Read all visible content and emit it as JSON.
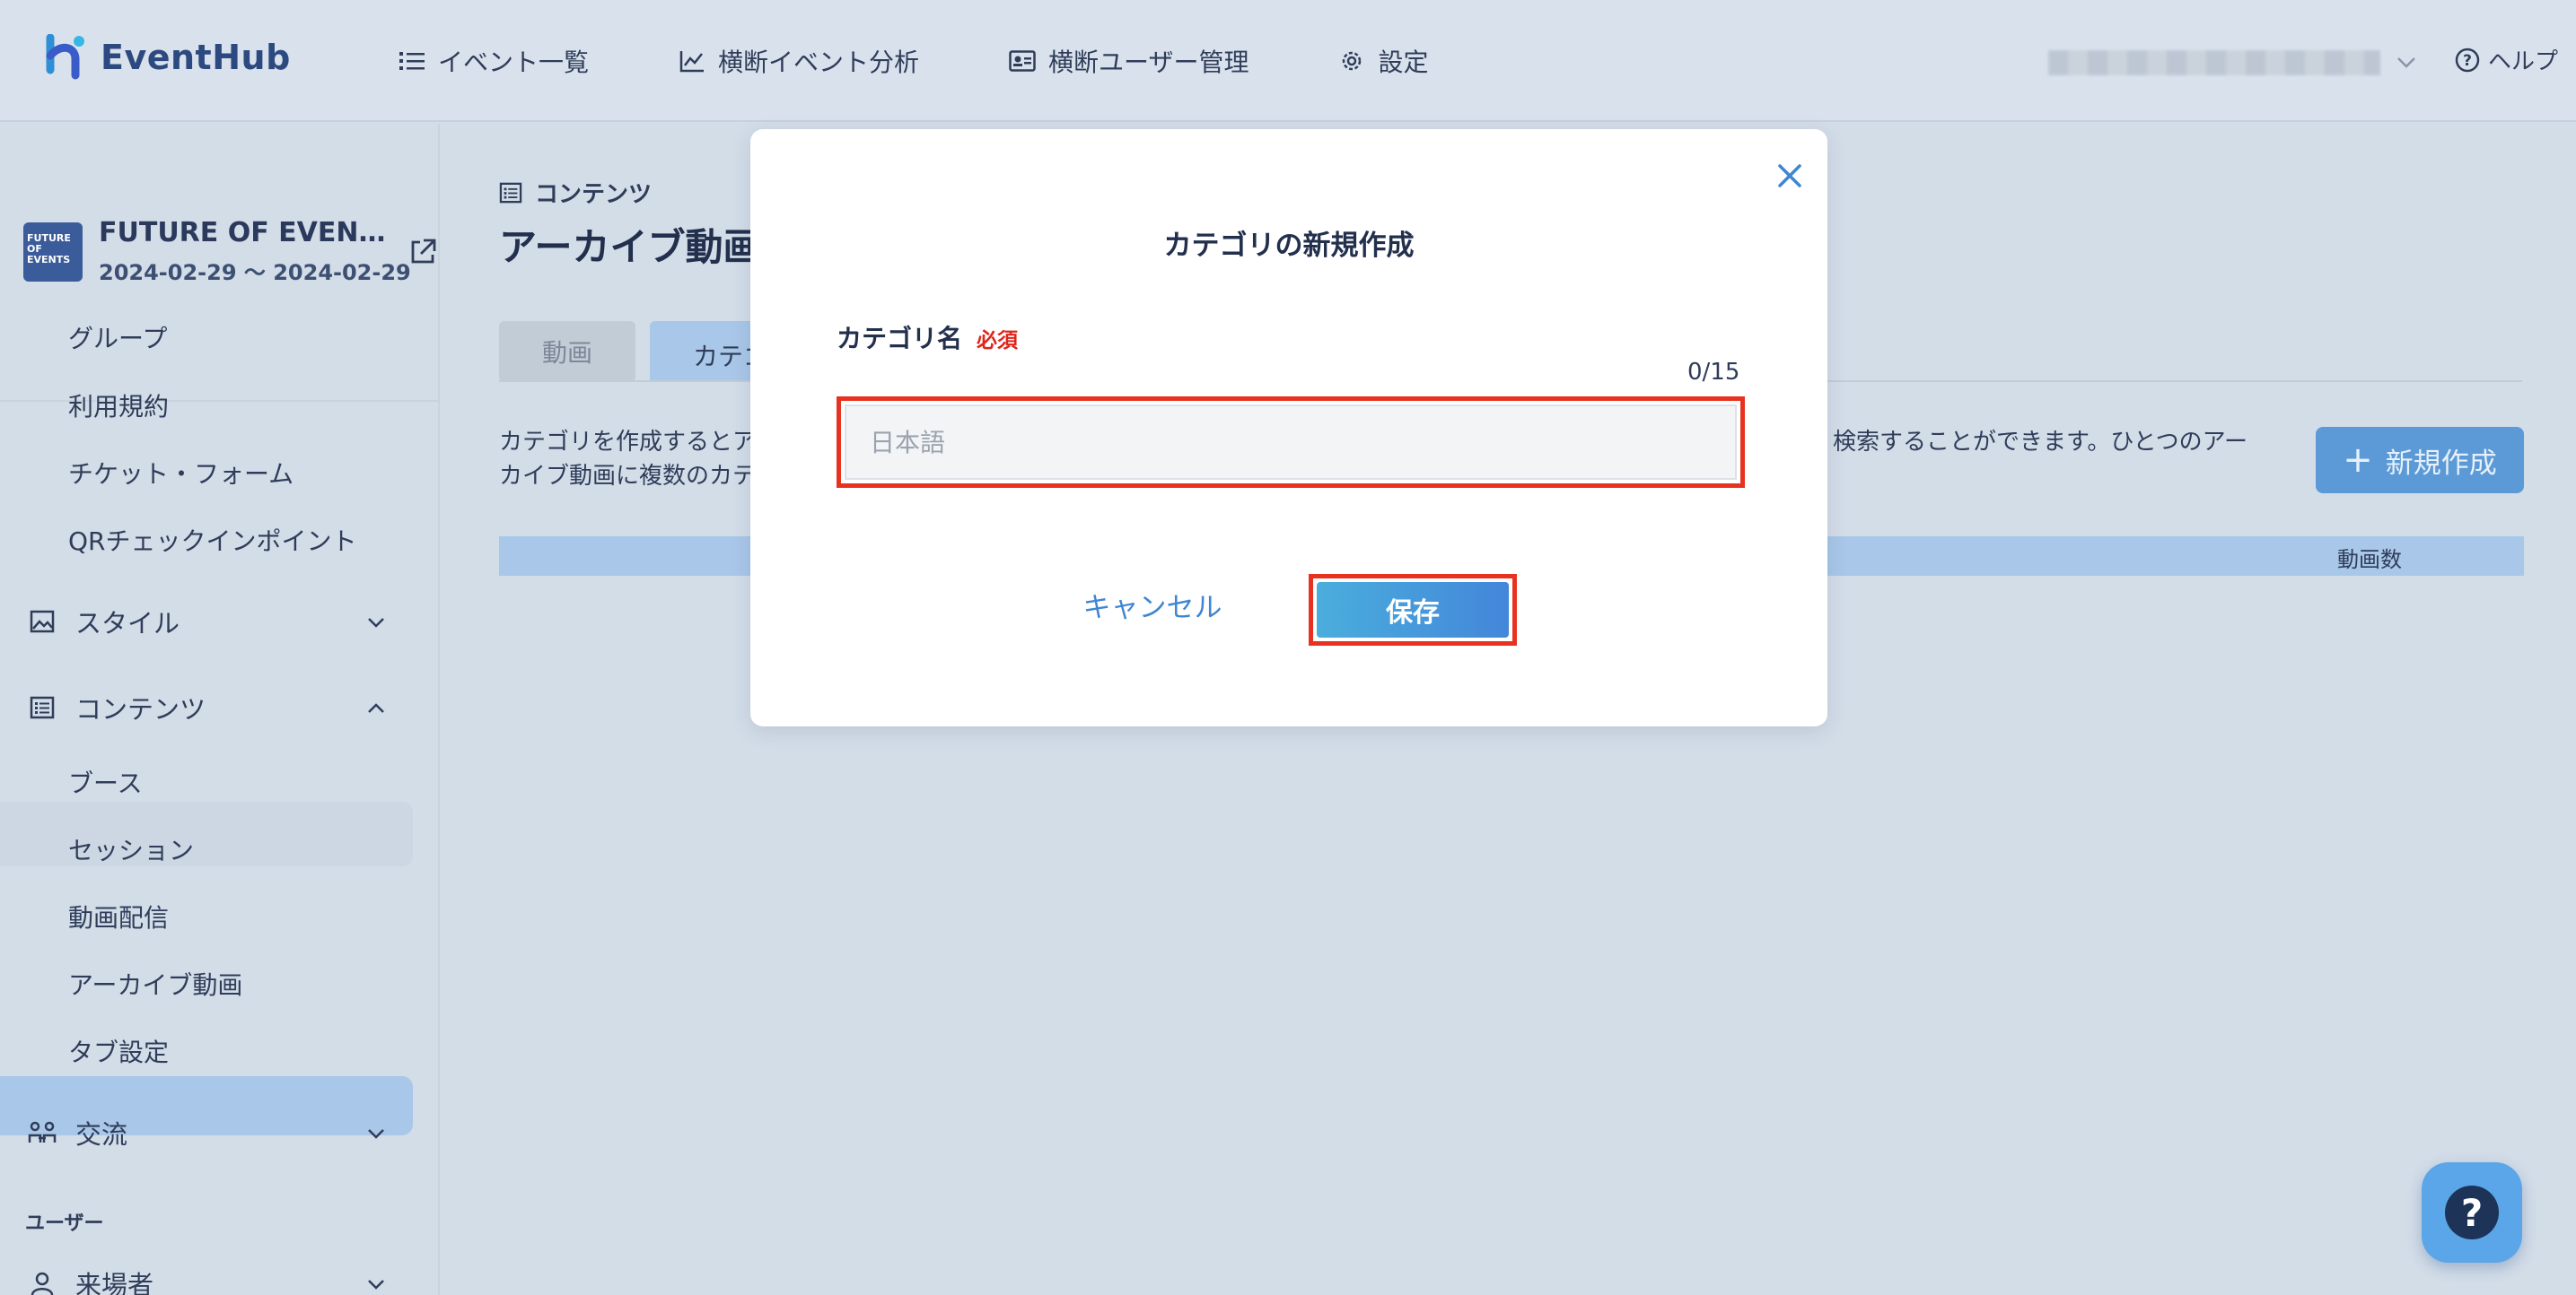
{
  "brand": {
    "name": "EventHub"
  },
  "nav": {
    "items": [
      {
        "label": "イベント一覧",
        "icon": "list-icon"
      },
      {
        "label": "横断イベント分析",
        "icon": "chart-line-icon"
      },
      {
        "label": "横断ユーザー管理",
        "icon": "id-card-icon"
      },
      {
        "label": "設定",
        "icon": "gear-icon"
      }
    ],
    "help_label": "ヘルプ"
  },
  "event": {
    "thumb_text": "FUTURE OF EVENTS",
    "title": "FUTURE OF EVEN…",
    "dates": "2024-02-29 〜 2024-02-29"
  },
  "sidebar": {
    "sub_items_top": [
      "グループ",
      "利用規約",
      "チケット・フォーム",
      "QRチェックインポイント"
    ],
    "style_label": "スタイル",
    "content_label": "コンテンツ",
    "content_items": [
      "ブース",
      "セッション",
      "動画配信",
      "アーカイブ動画",
      "タブ設定"
    ],
    "exchange_label": "交流",
    "user_section": "ユーザー",
    "visitors_label": "来場者"
  },
  "main": {
    "breadcrumb": "コンテンツ",
    "title": "アーカイブ動画",
    "tab_video": "動画",
    "tab_category": "カテゴリ",
    "desc_line1": "カテゴリを作成するとア",
    "desc_line2": "カイブ動画に複数のカテ",
    "desc_right": "示・検索することができます。ひとつのアー",
    "new_button": "新規作成",
    "column_video_count": "動画数"
  },
  "modal": {
    "title": "カテゴリの新規作成",
    "field_label": "カテゴリ名",
    "required_label": "必須",
    "counter": "0/15",
    "input_placeholder": "日本語",
    "cancel_label": "キャンセル",
    "save_label": "保存"
  },
  "colors": {
    "accent": "#4386da",
    "highlight_border": "#e8321f",
    "required": "#e0241a"
  }
}
